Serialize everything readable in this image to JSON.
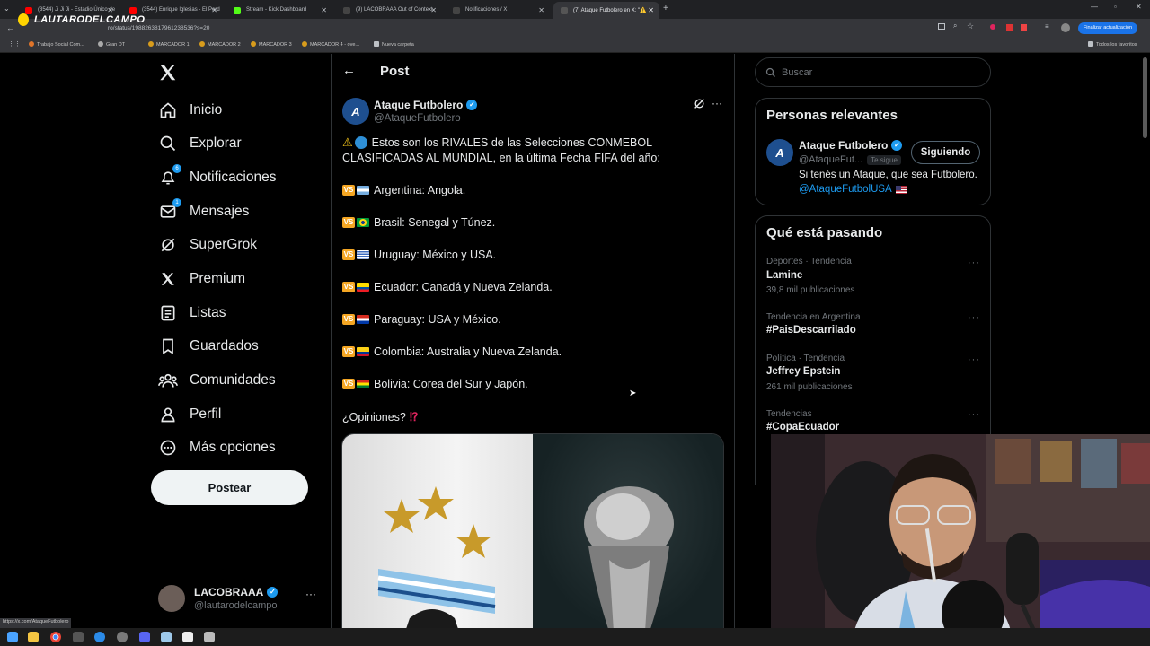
{
  "browser": {
    "tabs": [
      {
        "label": "(3544) Ji Ji Ji - Estadio Único de"
      },
      {
        "label": "(3544) Enrique Iglesias - El Perd"
      },
      {
        "label": "Stream - Kick Dashboard"
      },
      {
        "label": "(9) LACOBRAAA Out of Context"
      },
      {
        "label": "Notificaciones / X"
      },
      {
        "label": "(7) Ataque Futbolero en X: \"⚠️"
      }
    ],
    "url": "ro/status/1988263817961238536?s=20",
    "update_button": "Finalizar actualización",
    "bookmarks": [
      "Trabajo Social Com...",
      "Gran DT",
      "MARCADOR 1",
      "MARCADOR 2",
      "MARCADOR 3",
      "MARCADOR 4 - ove...",
      "Nueva carpeta"
    ],
    "all_bookmarks": "Todos los favoritos",
    "status_url": "https://x.com/AtaqueFutbolero"
  },
  "overlay_logo": "LAUTARODELCAMPO",
  "nav": {
    "items": [
      {
        "label": "Inicio",
        "icon": "home-icon"
      },
      {
        "label": "Explorar",
        "icon": "search-icon"
      },
      {
        "label": "Notificaciones",
        "icon": "bell-icon",
        "badge": "6"
      },
      {
        "label": "Mensajes",
        "icon": "mail-icon",
        "badge": "1"
      },
      {
        "label": "SuperGrok",
        "icon": "grok-icon"
      },
      {
        "label": "Premium",
        "icon": "x-logo-icon"
      },
      {
        "label": "Listas",
        "icon": "list-icon"
      },
      {
        "label": "Guardados",
        "icon": "bookmark-icon"
      },
      {
        "label": "Comunidades",
        "icon": "communities-icon"
      },
      {
        "label": "Perfil",
        "icon": "person-icon"
      },
      {
        "label": "Más opciones",
        "icon": "more-circle-icon"
      }
    ],
    "post_button": "Postear",
    "account": {
      "name": "LACOBRAAA",
      "handle": "@lautarodelcampo"
    }
  },
  "post": {
    "header_title": "Post",
    "author_name": "Ataque Futbolero",
    "author_handle": "@AtaqueFutbolero",
    "intro_line1": "Estos son los RIVALES de las Selecciones CONMEBOL",
    "intro_line2": "CLASIFICADAS AL MUNDIAL, en la última Fecha FIFA del año:",
    "fixtures": [
      {
        "text": "Argentina: Angola.",
        "flag": "argentina"
      },
      {
        "text": "Brasil: Senegal y Túnez.",
        "flag": "brasil"
      },
      {
        "text": "Uruguay: México y USA.",
        "flag": "uruguay"
      },
      {
        "text": "Ecuador: Canadá y Nueva Zelanda.",
        "flag": "ecuador"
      },
      {
        "text": "Paraguay: USA y México.",
        "flag": "paraguay"
      },
      {
        "text": "Colombia: Australia y Nueva Zelanda.",
        "flag": "colombia"
      },
      {
        "text": "Bolivia: Corea del Sur y Japón.",
        "flag": "bolivia"
      }
    ],
    "vs_label": "VS",
    "question": "¿Opiniones?"
  },
  "sidebar": {
    "search_placeholder": "Buscar",
    "relevant_title": "Personas relevantes",
    "relevant": {
      "name": "Ataque Futbolero",
      "handle": "@AtaqueFut...",
      "follows_you": "Te sigue",
      "button": "Siguiendo",
      "bio_line1": "Si tenés un Ataque, que sea Futbolero.",
      "bio_line2": "@AtaqueFutbolUSA"
    },
    "trends_title": "Qué está pasando",
    "trends": [
      {
        "meta": "Deportes · Tendencia",
        "name": "Lamine",
        "count": "39,8 mil publicaciones"
      },
      {
        "meta": "Tendencia en Argentina",
        "name": "#PaisDescarrilado",
        "count": ""
      },
      {
        "meta": "Política · Tendencia",
        "name": "Jeffrey Epstein",
        "count": "261 mil publicaciones"
      },
      {
        "meta": "Tendencias",
        "name": "#CopaEcuador",
        "count": ""
      }
    ]
  },
  "colors": {
    "accent": "#1d9bf0",
    "background": "#000000",
    "border": "#2f3336",
    "vs_badge": "#f4a623"
  }
}
